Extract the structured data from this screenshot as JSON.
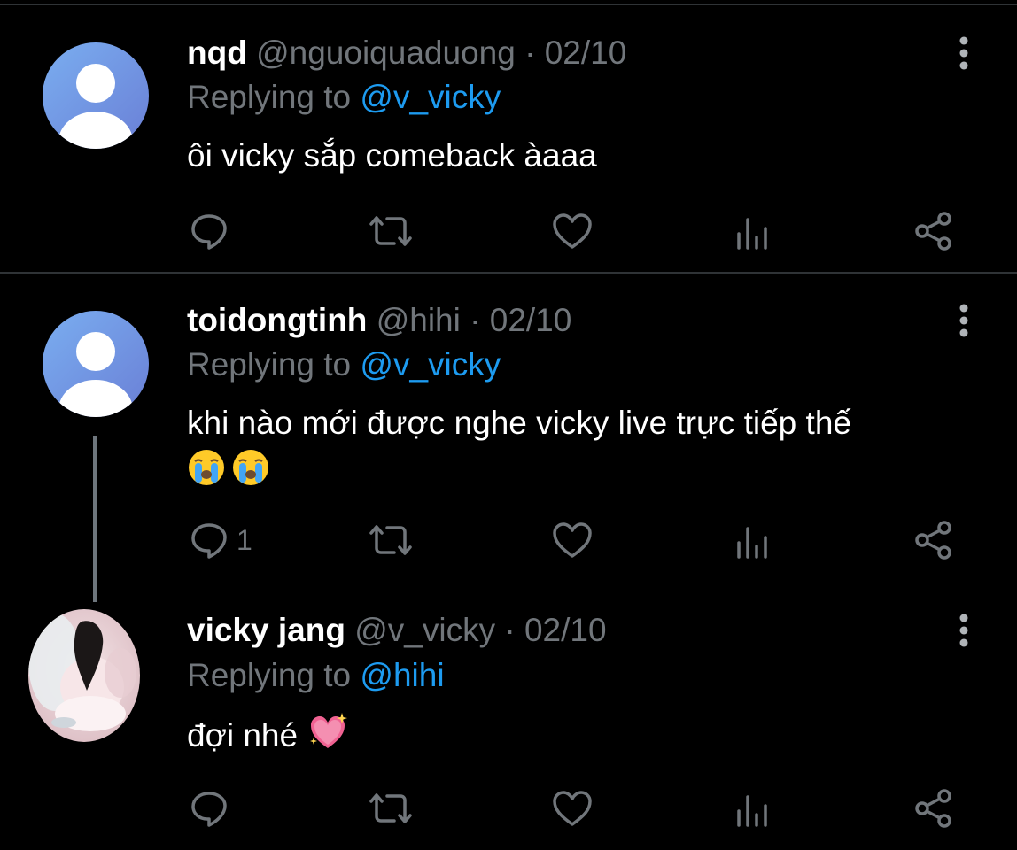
{
  "tweets": [
    {
      "name": "nqd",
      "handle": "@nguoiquaduong",
      "separator": "·",
      "date": "02/10",
      "replying_prefix": "Replying to",
      "replying_to": "@v_vicky",
      "text": "ôi vicky sắp comeback àaaa",
      "emojis": [],
      "reply_count": "",
      "avatar": "default-avatar"
    },
    {
      "name": "toidongtinh",
      "handle": "@hihi",
      "separator": "·",
      "date": "02/10",
      "replying_prefix": "Replying to",
      "replying_to": "@v_vicky",
      "text": "khi nào mới được nghe vicky live trực tiếp thế",
      "emojis": [
        "loudly-crying-face",
        "loudly-crying-face"
      ],
      "reply_count": "1",
      "avatar": "default-avatar"
    },
    {
      "name": "vicky jang",
      "handle": "@v_vicky",
      "separator": "·",
      "date": "02/10",
      "replying_prefix": "Replying to",
      "replying_to": "@hihi",
      "text": "đợi nhé",
      "emojis": [
        "sparkling-heart"
      ],
      "reply_count": "",
      "avatar": "photo-avatar"
    }
  ],
  "action_icons": [
    "reply-icon",
    "retweet-icon",
    "like-icon",
    "views-icon",
    "share-icon"
  ],
  "colors": {
    "background": "#000000",
    "text": "#ffffff",
    "muted": "#71767b",
    "mention": "#1d9bf0",
    "divider": "#2f3336",
    "thread_line": "#6e767d"
  }
}
